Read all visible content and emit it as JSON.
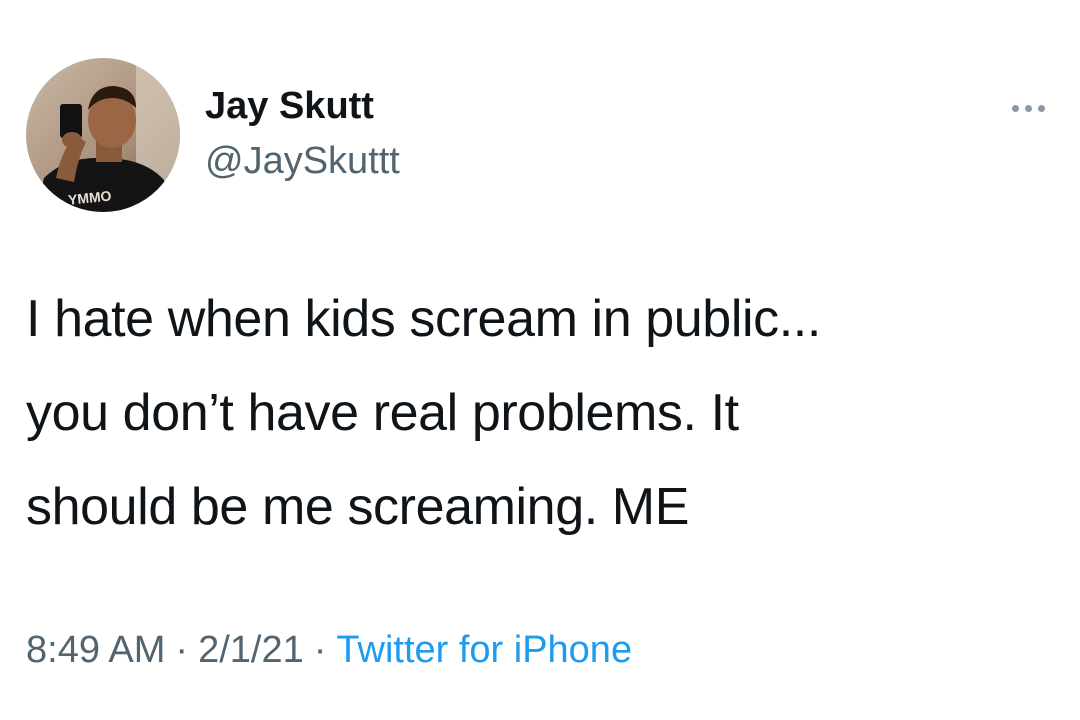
{
  "author": {
    "display_name": "Jay Skutt",
    "handle": "@JaySkuttt",
    "avatar_shirt_text": "YMMO"
  },
  "more_icon": "more-horizontal-icon",
  "tweet": {
    "lines": [
      "I hate when kids scream in public...",
      "you don’t have real problems. It",
      "should be me screaming. ME"
    ]
  },
  "meta": {
    "time": "8:49 AM",
    "separator": "·",
    "date": "2/1/21",
    "source": "Twitter for iPhone"
  },
  "colors": {
    "text": "#0f1419",
    "secondary_text": "#536471",
    "link": "#1d9bf0",
    "more_dots": "#8b98a5"
  }
}
